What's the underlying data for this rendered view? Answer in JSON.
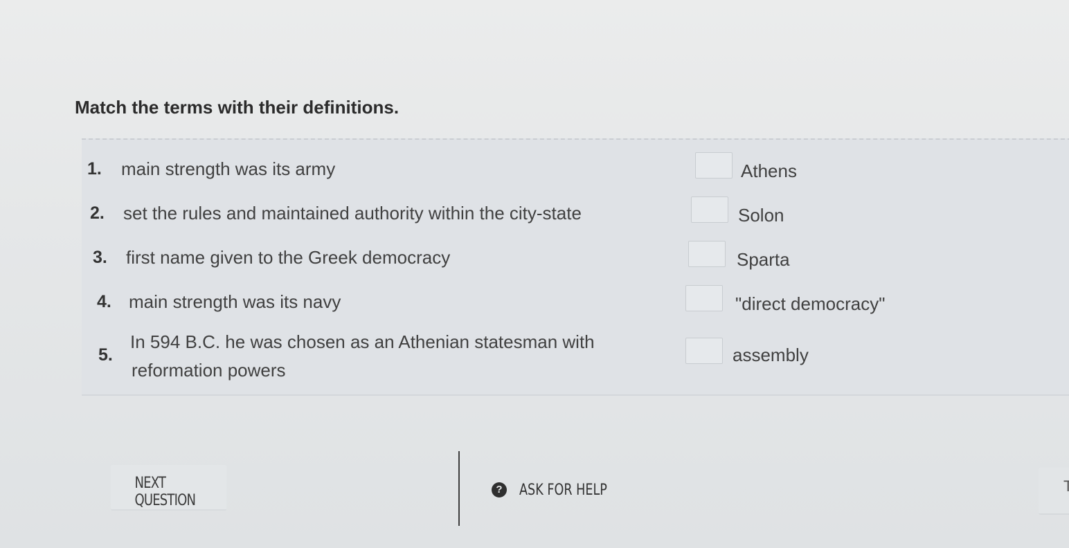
{
  "question": {
    "title": "Match the terms with their definitions."
  },
  "terms": [
    {
      "number": "1.",
      "text": "main strength was its army"
    },
    {
      "number": "2.",
      "text": "set the rules and maintained authority within the city-state"
    },
    {
      "number": "3.",
      "text": "first name given to the Greek democracy"
    },
    {
      "number": "4.",
      "text": "main strength was its navy"
    },
    {
      "number": "5.",
      "text_line1": "In 594 B.C. he was chosen as an Athenian statesman with",
      "text_line2": "reformation powers"
    }
  ],
  "answers": [
    "Athens",
    "Solon",
    "Sparta",
    "\"direct democracy\"",
    "assembly"
  ],
  "footer": {
    "next_label": "NEXT QUESTION",
    "help_icon": "question-circle-icon",
    "help_icon_glyph": "?",
    "help_label": "ASK FOR HELP",
    "edge_label": "T"
  }
}
